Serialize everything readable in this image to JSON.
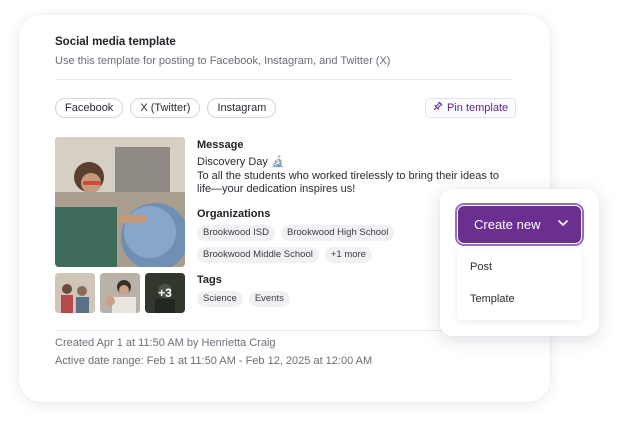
{
  "card": {
    "title": "Social media template",
    "subtitle": "Use this template for posting to Facebook, Instagram, and Twitter (X)"
  },
  "platforms": [
    "Facebook",
    "X (Twitter)",
    "Instagram"
  ],
  "pin": {
    "label": "Pin template",
    "icon": "pin-icon"
  },
  "images": {
    "more_count": "+3"
  },
  "message": {
    "label": "Message",
    "lines": [
      "Discovery Day 🔬",
      "To all the students who worked tirelessly to bring their ideas to",
      "life—your dedication inspires us!"
    ]
  },
  "organizations": {
    "label": "Organizations",
    "items": [
      "Brookwood ISD",
      "Brookwood High School",
      "Brookwood Middle School",
      "+1 more"
    ]
  },
  "tags": {
    "label": "Tags",
    "items": [
      "Science",
      "Events"
    ]
  },
  "meta": {
    "created": "Created Apr 1 at 11:50 AM by Henrietta Craig",
    "range": "Active date range: Feb 1 at 11:50 AM - Feb 12, 2025 at 12:00 AM"
  },
  "dropdown": {
    "button_label": "Create new",
    "options": [
      "Post",
      "Template"
    ]
  },
  "colors": {
    "accent": "#6b2f91",
    "accent_focus": "#9a6cc0",
    "pin_text": "#5b2a86"
  }
}
